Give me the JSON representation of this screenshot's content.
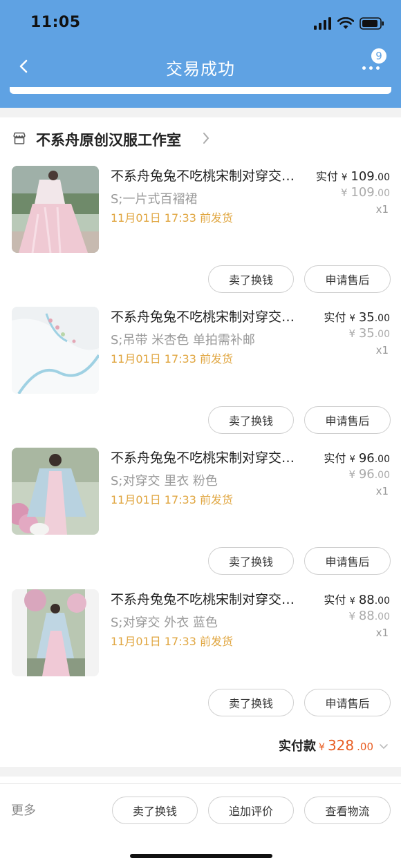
{
  "status_bar": {
    "time": "11:05"
  },
  "nav": {
    "title": "交易成功",
    "badge_count": "9"
  },
  "shop": {
    "name": "不系舟原创汉服工作室"
  },
  "items": [
    {
      "title": "不系舟兔兔不吃桃宋制对穿交领褙子",
      "spec": "S;一片式百褶裙",
      "ship": "11月01日 17:33 前发货",
      "paid_label": "实付",
      "currency": "¥",
      "paid_int": "109",
      "paid_dec": ".00",
      "orig_int": "109",
      "orig_dec": ".00",
      "qty": "x1",
      "sell_label": "卖了换钱",
      "after_label": "申请售后"
    },
    {
      "title": "不系舟兔兔不吃桃宋制对穿交领褙子",
      "spec": "S;吊带 米杏色 单拍需补邮",
      "ship": "11月01日 17:33 前发货",
      "paid_label": "实付",
      "currency": "¥",
      "paid_int": "35",
      "paid_dec": ".00",
      "orig_int": "35",
      "orig_dec": ".00",
      "qty": "x1",
      "sell_label": "卖了换钱",
      "after_label": "申请售后"
    },
    {
      "title": "不系舟兔兔不吃桃宋制对穿交领褙子",
      "spec": "S;对穿交 里衣 粉色",
      "ship": "11月01日 17:33 前发货",
      "paid_label": "实付",
      "currency": "¥",
      "paid_int": "96",
      "paid_dec": ".00",
      "orig_int": "96",
      "orig_dec": ".00",
      "qty": "x1",
      "sell_label": "卖了换钱",
      "after_label": "申请售后"
    },
    {
      "title": "不系舟兔兔不吃桃宋制对穿交领褙子",
      "spec": "S;对穿交 外衣 蓝色",
      "ship": "11月01日 17:33 前发货",
      "paid_label": "实付",
      "currency": "¥",
      "paid_int": "88",
      "paid_dec": ".00",
      "orig_int": "88",
      "orig_dec": ".00",
      "qty": "x1",
      "sell_label": "卖了换钱",
      "after_label": "申请售后"
    }
  ],
  "total": {
    "label": "实付款",
    "currency": "¥",
    "int": "328",
    "dec": ".00"
  },
  "bottom": {
    "more": "更多",
    "sell": "卖了换钱",
    "review": "追加评价",
    "logistics": "查看物流"
  },
  "colors": {
    "header_bg": "#5fa2e3",
    "price_accent": "#e85d22",
    "ship_text": "#e0a640"
  }
}
